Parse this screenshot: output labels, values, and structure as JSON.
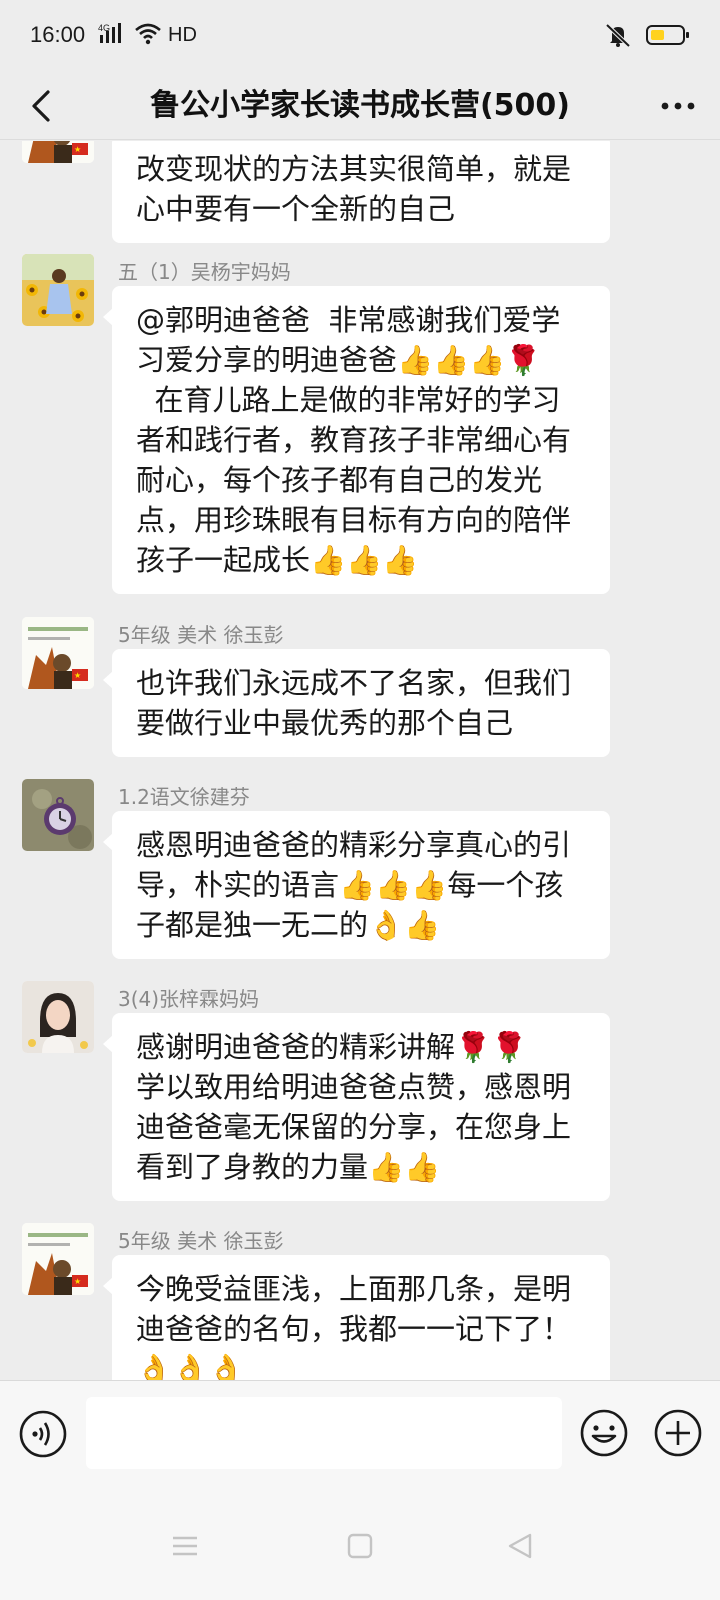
{
  "status": {
    "time": "16:00",
    "network": "4G",
    "hd": "HD"
  },
  "header": {
    "title": "鲁公小学家长读书成长营(500)"
  },
  "messages": [
    {
      "sender": "",
      "text": "改变现状的方法其实很简单，就是\n心中要有一个全新的自己",
      "avatar": "avatar-art-teacher-icon"
    },
    {
      "sender": "五（1）吴杨宇妈妈",
      "text": "@郭明迪爸爸  非常感谢我们爱学习爱分享的明迪爸爸👍👍👍🌹\n  在育儿路上是做的非常好的学习者和践行者，教育孩子非常细心有耐心，每个孩子都有自己的发光点，用珍珠眼有目标有方向的陪伴孩子一起成长👍👍👍",
      "avatar": "avatar-sunflower-girl-icon"
    },
    {
      "sender": "5年级 美术 徐玉彭",
      "text": "也许我们永远成不了名家，但我们\n要做行业中最优秀的那个自己",
      "avatar": "avatar-art-teacher-icon"
    },
    {
      "sender": "1.2语文徐建芬",
      "text": "感恩明迪爸爸的精彩分享真心的引导，朴实的语言👍👍👍每一个孩子都是独一无二的👌👍",
      "avatar": "avatar-pocket-watch-icon"
    },
    {
      "sender": "3(4)张梓霖妈妈",
      "text": "感谢明迪爸爸的精彩讲解🌹🌹\n学以致用给明迪爸爸点赞，感恩明迪爸爸毫无保留的分享，在您身上看到了身教的力量👍👍",
      "avatar": "avatar-woman-portrait-icon"
    },
    {
      "sender": "5年级 美术 徐玉彭",
      "text": "今晚受益匪浅，上面那几条，是明迪爸爸的名句，我都一一记下了！\n👌👌👌",
      "avatar": "avatar-art-teacher-icon"
    }
  ],
  "input": {
    "placeholder": ""
  },
  "colors": {
    "background": "#EDEDED",
    "bubble": "#FFFFFF",
    "sender_text": "#888888",
    "battery": "#FFD21E"
  }
}
